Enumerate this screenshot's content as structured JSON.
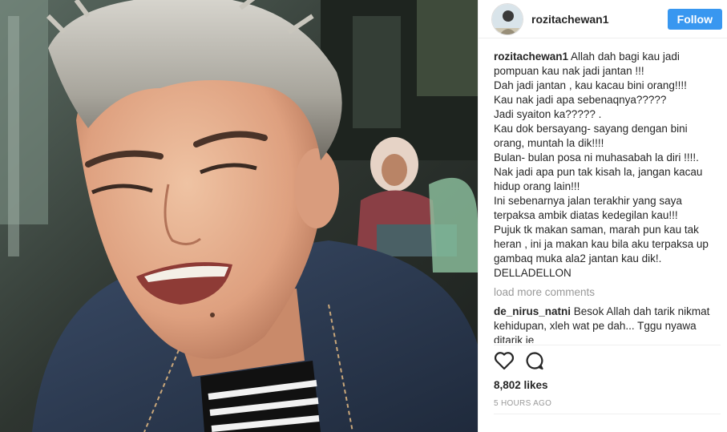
{
  "post": {
    "username": "rozitachewan1",
    "follow_label": "Follow",
    "caption_username": "rozitachewan1",
    "caption_text": "Allah dah bagi kau jadi pompuan kau nak jadi jantan !!!\nDah jadi jantan , kau kacau bini orang!!!!\nKau nak jadi apa sebenaqnya?????\nJadi syaiton ka????? .\nKau dok bersayang- sayang dengan bini orang, muntah la dik!!!!\nBulan- bulan posa ni muhasabah la diri !!!!.\nNak jadi apa pun tak kisah la, jangan kacau hidup orang lain!!!\nIni sebenarnya jalan terakhir yang saya terpaksa ambik diatas kedegilan kau!!!\nPujuk tk makan saman, marah pun kau tak heran , ini ja makan kau bila aku terpaksa up gambaq muka ala2 jantan kau dik!.\nDELLADELLON",
    "load_more_label": "load more comments",
    "comments": [
      {
        "username": "de_nirus_natni",
        "text": "Besok Allah dah tarik nikmat kehidupan, xleh wat pe dah... Tggu nyawa ditarik je"
      }
    ],
    "likes": "8,802 likes",
    "timestamp": "5 HOURS AGO"
  },
  "icons": {
    "like": "heart-outline-icon",
    "comment": "speech-bubble-icon"
  },
  "colors": {
    "follow_button": "#3897f0",
    "muted_text": "#999999",
    "text": "#262626"
  }
}
